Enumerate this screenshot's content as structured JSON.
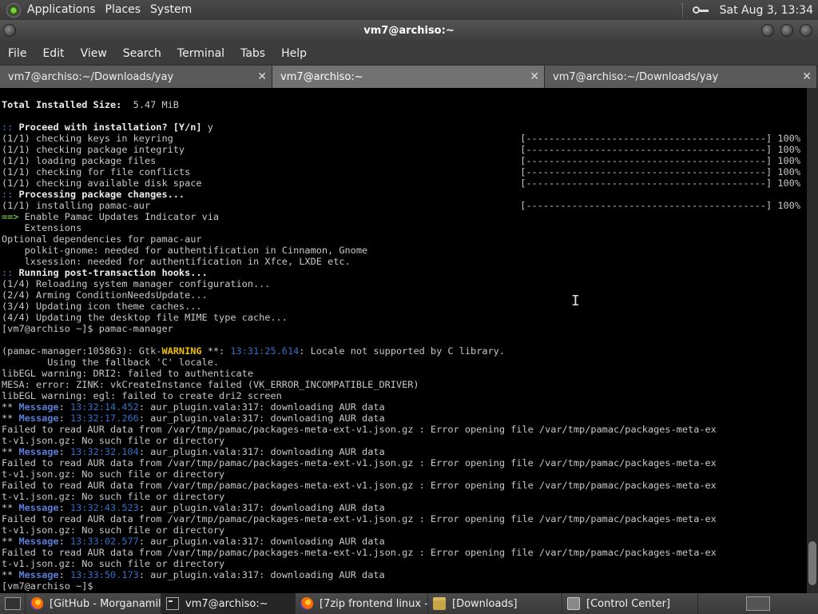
{
  "top_panel": {
    "menus": [
      "Applications",
      "Places",
      "System"
    ],
    "clock": "Sat Aug  3, 13:34",
    "tray_icons": [
      "distro-logo-icon",
      "key-icon"
    ]
  },
  "window": {
    "title": "vm7@archiso:~"
  },
  "menubar": [
    "File",
    "Edit",
    "View",
    "Search",
    "Terminal",
    "Tabs",
    "Help"
  ],
  "tabs": [
    {
      "label": "vm7@archiso:~/Downloads/yay",
      "active": false
    },
    {
      "label": "vm7@archiso:~",
      "active": true
    },
    {
      "label": "vm7@archiso:~/Downloads/yay",
      "active": false
    }
  ],
  "terminal": {
    "total_size_label": "Total Installed Size:",
    "total_size_value": "  5.47 MiB",
    "proceed_prefix": "::",
    "proceed_text": " Proceed with installation? [Y/n]",
    "proceed_answer": " y",
    "progress_bar": "[------------------------------------------] 100%",
    "steps": [
      "(1/1) checking keys in keyring",
      "(1/1) checking package integrity",
      "(1/1) loading package files",
      "(1/1) checking for file conflicts",
      "(1/1) checking available disk space"
    ],
    "processing_prefix": "::",
    "processing_text": " Processing package changes...",
    "installing": "(1/1) installing pamac-aur",
    "enable_arrow": "==>",
    "enable_text": " Enable Pamac Updates Indicator via",
    "enable_cont": "    Extensions",
    "optdeps_header": "Optional dependencies for pamac-aur",
    "optdeps": [
      "    polkit-gnome: needed for authentification in Cinnamon, Gnome",
      "    lxsession: needed for authentification in Xfce, LXDE etc."
    ],
    "hooks_prefix": "::",
    "hooks_text": " Running post-transaction hooks...",
    "hooks": [
      "(1/4) Reloading system manager configuration...",
      "(2/4) Arming ConditionNeedsUpdate...",
      "(3/4) Updating icon theme caches...",
      "(4/4) Updating the desktop file MIME type cache..."
    ],
    "prompt1": "[vm7@archiso ~]$ pamac-manager",
    "gtk_prefix": "(pamac-manager:105863): Gtk-",
    "gtk_warning": "WARNING",
    "gtk_stars": " **: ",
    "gtk_time": "13:31:25.614",
    "gtk_msg": ": Locale not supported by C library.",
    "gtk_cont": "        Using the fallback 'C' locale.",
    "egl1": "libEGL warning: DRI2: failed to authenticate",
    "mesa": "MESA: error: ZINK: vkCreateInstance failed (VK_ERROR_INCOMPATIBLE_DRIVER)",
    "egl2": "libEGL warning: egl: failed to create dri2 screen",
    "msg_stars": "** ",
    "msg_label": "Message",
    "msg_text": ": aur_plugin.vala:317: downloading AUR data",
    "fail_line1": "Failed to read AUR data from /var/tmp/pamac/packages-meta-ext-v1.json.gz : Error opening file /var/tmp/pamac/packages-meta-ex",
    "fail_line2": "t-v1.json.gz: No such file or directory",
    "msg_times": [
      "13:32:14.452",
      "13:32:17.266",
      "13:32:32.104",
      "13:32:43.523",
      "13:33:02.577",
      "13:33:50.173"
    ],
    "prompt2": "[vm7@archiso ~]$"
  },
  "taskbar": [
    {
      "label": "[GitHub - Morganamil...",
      "icon": "firefox-icon",
      "active": false
    },
    {
      "label": "vm7@archiso:~",
      "icon": "terminal-icon",
      "active": true
    },
    {
      "label": "[7zip frontend linux - ...",
      "icon": "firefox-icon",
      "active": false
    },
    {
      "label": "[Downloads]",
      "icon": "folder-icon",
      "active": false
    },
    {
      "label": "[Control Center]",
      "icon": "control-center-icon",
      "active": false
    }
  ]
}
